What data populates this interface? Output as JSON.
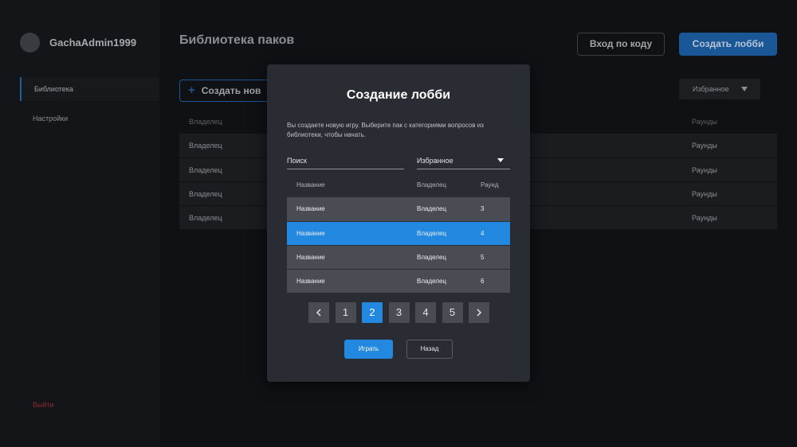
{
  "sidebar": {
    "username": "GachaAdmin1999",
    "items": [
      {
        "label": "Библиотека",
        "active": true
      },
      {
        "label": "Настройки",
        "active": false
      }
    ],
    "logout_label": "Выйти"
  },
  "header": {
    "title": "Библиотека паков",
    "join_label": "Вход по коду",
    "create_lobby_label": "Создать лобби"
  },
  "toolbar": {
    "create_pack_label": "Создать нов",
    "filter_value": "Избранное"
  },
  "library_table": {
    "owner_col": "Владелец",
    "rounds_col": "Раунды",
    "rows": [
      {
        "owner": "Владелец",
        "rounds": "Раунды"
      },
      {
        "owner": "Владелец",
        "rounds": "Раунды"
      },
      {
        "owner": "Владелец",
        "rounds": "Раунды"
      },
      {
        "owner": "Владелец",
        "rounds": "Раунды"
      }
    ]
  },
  "modal": {
    "title": "Создание лобби",
    "description": "Вы создаете новую игру. Выберите пак с категориями вопросов из библиотеки, чтобы начать.",
    "search_placeholder": "Поиск",
    "filter_value": "Избранное",
    "columns": {
      "name": "Название",
      "owner": "Владелец",
      "round": "Раунд"
    },
    "rows": [
      {
        "name": "Название",
        "owner": "Владелец",
        "round": "3",
        "selected": false
      },
      {
        "name": "Название",
        "owner": "Владелец",
        "round": "4",
        "selected": true
      },
      {
        "name": "Название",
        "owner": "Владелец",
        "round": "5",
        "selected": false
      },
      {
        "name": "Название",
        "owner": "Владелец",
        "round": "6",
        "selected": false
      }
    ],
    "pagination": {
      "pages": [
        "1",
        "2",
        "3",
        "4",
        "5"
      ],
      "current": "2",
      "prev_icon": "chevron-left-icon",
      "next_icon": "chevron-right-icon"
    },
    "play_label": "Играть",
    "back_label": "Назад"
  },
  "colors": {
    "accent": "#2288e0",
    "modal_bg": "#2a2c33",
    "danger": "#8a2b2f"
  }
}
